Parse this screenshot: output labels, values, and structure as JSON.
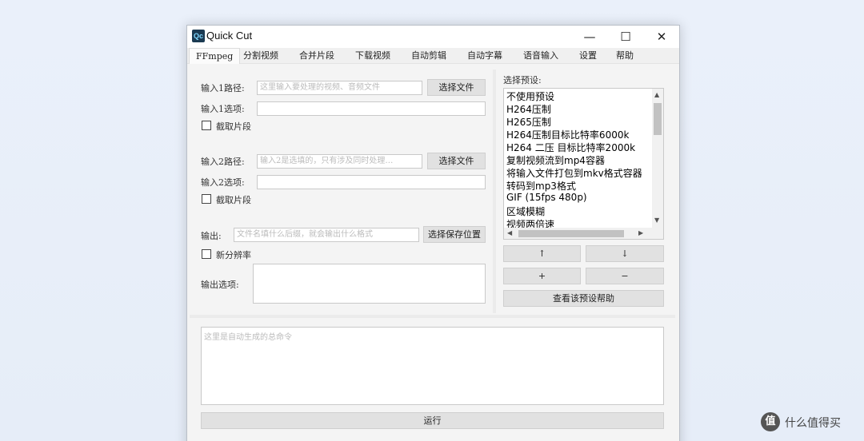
{
  "window": {
    "icon_text": "Qc",
    "title": "Quick Cut",
    "minimize": "—",
    "maximize": "☐",
    "close": "✕"
  },
  "tabs": [
    "FFmpeg",
    "分割视频",
    "合并片段",
    "下载视频",
    "自动剪辑",
    "自动字幕",
    "语音输入",
    "设置",
    "帮助"
  ],
  "ffmpeg": {
    "input1": {
      "path_label": "输入1路径:",
      "path_placeholder": "这里输入要处理的视频、音频文件",
      "choose_button": "选择文件",
      "options_label": "输入1选项:",
      "options_value": "",
      "clip_label": "截取片段"
    },
    "input2": {
      "path_label": "输入2路径:",
      "path_placeholder": "输入2是选填的，只有涉及同时处理…",
      "choose_button": "选择文件",
      "options_label": "输入2选项:",
      "options_value": "",
      "clip_label": "截取片段"
    },
    "output": {
      "label": "输出:",
      "placeholder": "文件名填什么后缀，就会输出什么格式",
      "save_button": "选择保存位置",
      "resolution_label": "新分辨率",
      "options_label": "输出选项:"
    },
    "presets": {
      "label": "选择预设:",
      "items": [
        "不使用预设",
        "H264压制",
        "H265压制",
        "H264压制目标比特率6000k",
        "H264 二压 目标比特率2000k",
        "复制视频流到mp4容器",
        "将输入文件打包到mkv格式容器",
        "转码到mp3格式",
        "GIF (15fps 480p)",
        "区域模糊",
        "视频两倍速"
      ],
      "up_button": "↑",
      "down_button": "↓",
      "add_button": "+",
      "remove_button": "−",
      "help_button": "查看该预设帮助"
    },
    "command_placeholder": "这里是自动生成的总命令",
    "run_button": "运行"
  },
  "watermark": {
    "logo": "值",
    "text": "什么值得买"
  }
}
